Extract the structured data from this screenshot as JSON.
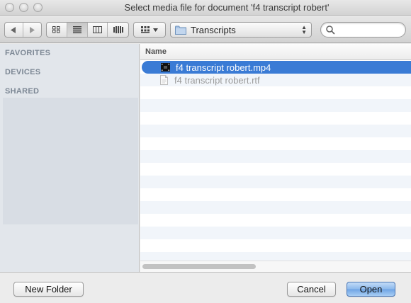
{
  "window": {
    "title": "Select media file for document 'f4 transcript robert'"
  },
  "toolbar": {
    "path_label": "Transcripts",
    "search_placeholder": "",
    "search_value": ""
  },
  "sidebar": {
    "sections": [
      "FAVORITES",
      "DEVICES",
      "SHARED"
    ]
  },
  "filelist": {
    "column_name": "Name",
    "files": [
      {
        "name": "f4 transcript robert.mp4",
        "icon": "video-file-icon",
        "state": "selected"
      },
      {
        "name": "f4 transcript robert.rtf",
        "icon": "document-file-icon",
        "state": "disabled"
      }
    ]
  },
  "buttons": {
    "new_folder": "New Folder",
    "cancel": "Cancel",
    "open": "Open"
  },
  "colors": {
    "selection": "#3a7bd5",
    "sidebar_bg": "#e2e6eb",
    "row_alt": "#f1f5fa",
    "default_button": "#8bb8ec"
  }
}
